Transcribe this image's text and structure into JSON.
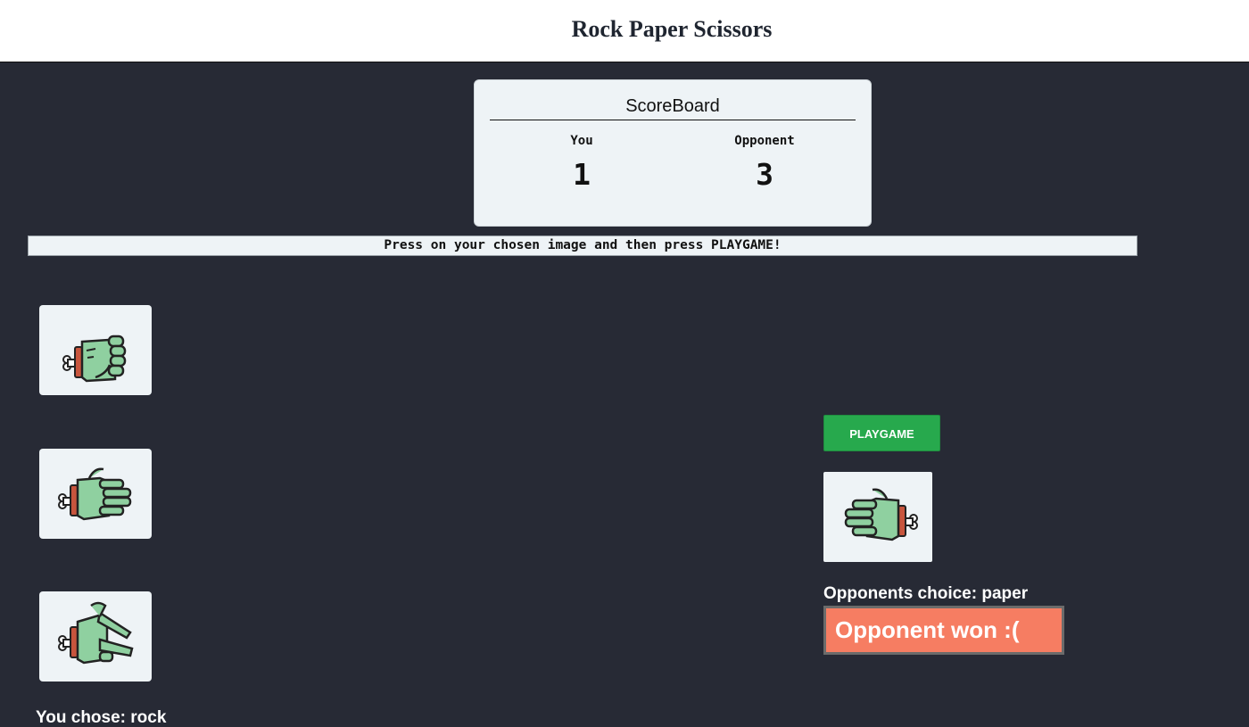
{
  "header": {
    "title": "Rock Paper Scissors"
  },
  "scoreboard": {
    "title": "ScoreBoard",
    "you_label": "You",
    "opponent_label": "Opponent",
    "you_score": "1",
    "opponent_score": "3"
  },
  "instruction": "Press on your chosen image and then press PLAYGAME!",
  "choices": [
    {
      "name": "rock",
      "icon": "zombie-fist-icon"
    },
    {
      "name": "paper",
      "icon": "zombie-open-hand-icon"
    },
    {
      "name": "scissors",
      "icon": "zombie-scissors-hand-icon"
    }
  ],
  "player": {
    "chose_text": "You chose: rock"
  },
  "play_button": {
    "label": "PLAYGAME"
  },
  "opponent": {
    "choice_icon": "zombie-open-hand-icon",
    "choice_text": "Opponents choice: paper"
  },
  "result": {
    "text": "Opponent won :("
  },
  "colors": {
    "background": "#272a35",
    "card": "#eef3f6",
    "play_button": "#27a94d",
    "result_box": "#f67d62",
    "hand_skin": "#8fd0a0",
    "hand_outline": "#222222",
    "sleeve": "#c8553d"
  }
}
